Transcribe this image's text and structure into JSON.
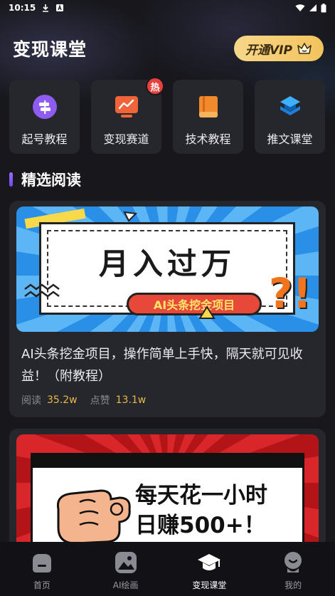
{
  "status_bar": {
    "time": "10:15"
  },
  "header": {
    "title": "变现课堂",
    "vip_label": "开通VIP"
  },
  "categories": [
    {
      "label": "起号教程",
      "icon": "signpost-icon",
      "color": "#8e5cf0"
    },
    {
      "label": "变现赛道",
      "icon": "trend-monitor-icon",
      "color": "#f0643a",
      "badge": "热"
    },
    {
      "label": "技术教程",
      "icon": "book-icon",
      "color": "#f08a2a"
    },
    {
      "label": "推文课堂",
      "icon": "layers-icon",
      "color": "#2a9cf0"
    }
  ],
  "section": {
    "title": "精选阅读"
  },
  "articles": [
    {
      "banner_headline": "月入过万",
      "banner_tag": "AI头条挖金项目",
      "banner_mark": "?!",
      "title": "AI头条挖金项目，操作简单上手快，隔天就可见收益！（附教程）",
      "read_label": "阅读",
      "read_count": "35.2w",
      "like_label": "点赞",
      "like_count": "13.1w"
    },
    {
      "banner_line1": "每天花一小时",
      "banner_line2": "日赚500+！"
    }
  ],
  "tabs": [
    {
      "label": "首页",
      "icon": "home-icon"
    },
    {
      "label": "AI绘画",
      "icon": "image-icon"
    },
    {
      "label": "变现课堂",
      "icon": "graduation-cap-icon",
      "active": true
    },
    {
      "label": "我的",
      "icon": "profile-icon"
    }
  ],
  "colors": {
    "accent_vip": "#f2c35c",
    "stat_value": "#e9b84a",
    "background": "#17171c"
  }
}
